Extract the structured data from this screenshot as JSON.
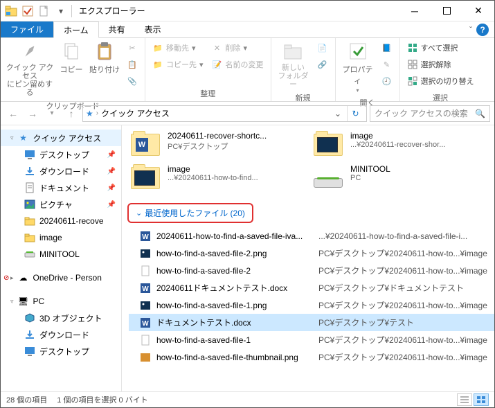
{
  "window": {
    "title": "エクスプローラー"
  },
  "tabs": {
    "file": "ファイル",
    "home": "ホーム",
    "share": "共有",
    "view": "表示"
  },
  "ribbon": {
    "clipboard": {
      "label": "クリップボード",
      "pin": "クイック アクセス\nにピン留めする",
      "copy": "コピー",
      "paste": "貼り付け"
    },
    "organize": {
      "label": "整理",
      "moveto": "移動先",
      "copyto": "コピー先",
      "delete": "削除",
      "rename": "名前の変更"
    },
    "new": {
      "label": "新規",
      "newfolder": "新しい\nフォルダー"
    },
    "open": {
      "label": "開く",
      "properties": "プロパティ"
    },
    "select": {
      "label": "選択",
      "all": "すべて選択",
      "none": "選択解除",
      "invert": "選択の切り替え"
    }
  },
  "address": {
    "location": "クイック アクセス",
    "search_placeholder": "クイック アクセスの検索"
  },
  "sidebar": {
    "quickaccess": "クイック アクセス",
    "items": [
      {
        "label": "デスクトップ",
        "pin": true,
        "icon": "desktop"
      },
      {
        "label": "ダウンロード",
        "pin": true,
        "icon": "download"
      },
      {
        "label": "ドキュメント",
        "pin": true,
        "icon": "document"
      },
      {
        "label": "ピクチャ",
        "pin": true,
        "icon": "picture"
      },
      {
        "label": "20240611-recove",
        "pin": false,
        "icon": "folder"
      },
      {
        "label": "image",
        "pin": false,
        "icon": "folder"
      },
      {
        "label": "MINITOOL",
        "pin": false,
        "icon": "disk"
      }
    ],
    "onedrive": "OneDrive - Person",
    "pc": "PC",
    "pc_items": [
      {
        "label": "3D オブジェクト",
        "icon": "3d"
      },
      {
        "label": "ダウンロード",
        "icon": "download"
      },
      {
        "label": "デスクトップ",
        "icon": "desktop"
      }
    ]
  },
  "frequent": [
    {
      "name": "20240611-recover-shortc...",
      "path": "PC¥デスクトップ",
      "icon": "folder-word"
    },
    {
      "name": "image",
      "path": "...¥20240611-recover-shor...",
      "icon": "folder-img"
    },
    {
      "name": "image",
      "path": "...¥20240611-how-to-find...",
      "icon": "folder-img"
    },
    {
      "name": "MINITOOL",
      "path": "PC",
      "icon": "disk"
    }
  ],
  "recent_header": "最近使用したファイル (20)",
  "recent": [
    {
      "name": "20240611-how-to-find-a-saved-file-iva...",
      "path": "...¥20240611-how-to-find-a-saved-file-i...",
      "icon": "word"
    },
    {
      "name": "how-to-find-a-saved-file-2.png",
      "path": "PC¥デスクトップ¥20240611-how-to...¥image",
      "icon": "png"
    },
    {
      "name": "how-to-find-a-saved-file-2",
      "path": "PC¥デスクトップ¥20240611-how-to...¥image",
      "icon": "blank"
    },
    {
      "name": "20240611ドキュメントテスト.docx",
      "path": "PC¥デスクトップ¥ドキュメントテスト",
      "icon": "word"
    },
    {
      "name": "how-to-find-a-saved-file-1.png",
      "path": "PC¥デスクトップ¥20240611-how-to...¥image",
      "icon": "png"
    },
    {
      "name": "ドキュメントテスト.docx",
      "path": "PC¥デスクトップ¥テスト",
      "icon": "word",
      "selected": true
    },
    {
      "name": "how-to-find-a-saved-file-1",
      "path": "PC¥デスクトップ¥20240611-how-to...¥image",
      "icon": "blank"
    },
    {
      "name": "how-to-find-a-saved-file-thumbnail.png",
      "path": "PC¥デスクトップ¥20240611-how-to...¥image",
      "icon": "png2"
    }
  ],
  "status": {
    "count": "28 個の項目",
    "sel": "1 個の項目を選択 0 バイト"
  }
}
